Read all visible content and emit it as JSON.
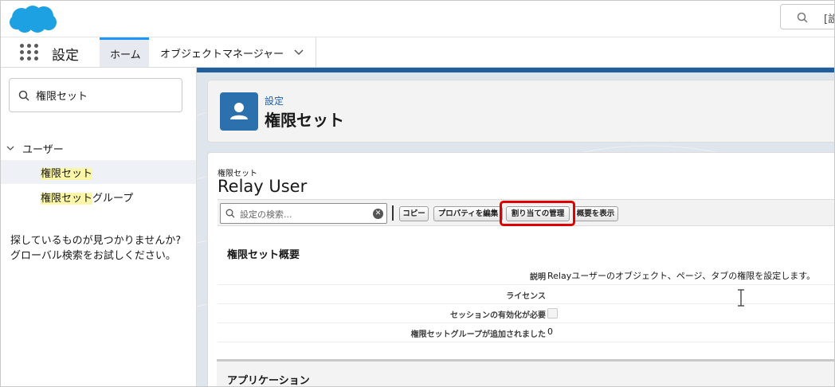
{
  "global_search": {
    "placeholder": "[設"
  },
  "nav": {
    "app_name": "設定",
    "tabs": [
      {
        "label": "ホーム"
      },
      {
        "label": "オブジェクトマネージャー"
      }
    ]
  },
  "sidebar": {
    "search_value": "権限セット",
    "group_label": "ユーザー",
    "items": [
      {
        "highlight": "権限セット",
        "rest": ""
      },
      {
        "highlight": "権限セット",
        "rest": "グループ"
      }
    ],
    "not_found_text": "探しているものが見つかりませんか? グローバル検索をお試しください。"
  },
  "page_header": {
    "eyebrow": "設定",
    "title": "権限セット"
  },
  "permission_set": {
    "eyebrow": "権限セット",
    "name": "Relay User",
    "search_placeholder": "設定の検索...",
    "buttons": {
      "copy": "コピー",
      "edit_properties": "プロパティを編集",
      "manage_assignments": "割り当ての管理",
      "view_summary": "概要を表示"
    },
    "section_title": "権限セット概要",
    "fields": [
      {
        "label": "説明",
        "value": "Relayユーザーのオブジェクト、ページ、タブの権限を設定します。"
      },
      {
        "label": "ライセンス",
        "value": ""
      },
      {
        "label": "セッションの有効化が必要",
        "value": "",
        "checked": false
      },
      {
        "label": "権限セットグループが追加されました",
        "value": "0"
      }
    ],
    "apps_section_title": "アプリケーション"
  },
  "colors": {
    "brand_blue": "#1f5f9e",
    "link_blue": "#1b5fa8",
    "highlight_yellow": "#fcf7a8",
    "callout_red": "#e00000"
  }
}
